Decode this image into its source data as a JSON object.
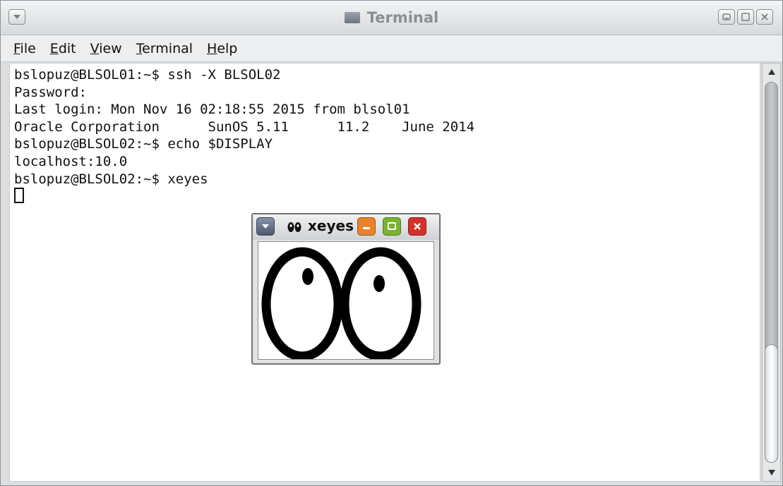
{
  "window": {
    "title": "Terminal",
    "icon": "terminal-icon"
  },
  "menubar": {
    "items": [
      {
        "accel": "F",
        "rest": "ile"
      },
      {
        "accel": "E",
        "rest": "dit"
      },
      {
        "accel": "V",
        "rest": "iew"
      },
      {
        "accel": "T",
        "rest": "erminal"
      },
      {
        "accel": "H",
        "rest": "elp"
      }
    ]
  },
  "terminal": {
    "lines": [
      "bslopuz@BLSOL01:~$ ssh -X BLSOL02",
      "Password:",
      "Last login: Mon Nov 16 02:18:55 2015 from blsol01",
      "Oracle Corporation      SunOS 5.11      11.2    June 2014",
      "bslopuz@BLSOL02:~$ echo $DISPLAY",
      "localhost:10.0",
      "bslopuz@BLSOL02:~$ xeyes"
    ]
  },
  "xeyes": {
    "title": "xeyes",
    "colors": {
      "minimize": "#e9822c",
      "maximize": "#79b330",
      "close": "#d2332b"
    }
  },
  "colors": {
    "text": "#111111",
    "background": "#ffffff",
    "chrome": "#dcdedf"
  }
}
